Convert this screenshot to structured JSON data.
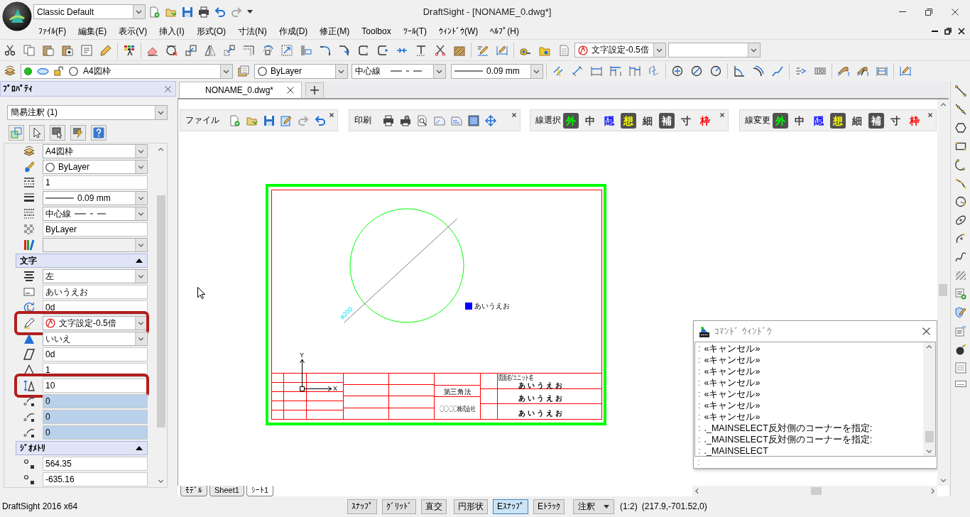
{
  "window": {
    "title": "DraftSight - [NONAME_0.dwg*]",
    "workspace": "Classic Default"
  },
  "menu": [
    "ﾌｧｲﾙ(F)",
    "編集(E)",
    "表示(V)",
    "挿入(I)",
    "形式(O)",
    "寸法(N)",
    "作成(D)",
    "修正(M)",
    "Toolbox",
    "ﾂｰﾙ(T)",
    "ｳｨﾝﾄﾞｳ(W)",
    "ﾍﾙﾌﾟ(H)"
  ],
  "toolbar": {
    "text_style": "文字設定-0.5倍"
  },
  "layer_bar": {
    "layer": "A4図枠",
    "color_setting": "ByLayer",
    "linetype": "中心線",
    "lineweight": "0.09 mm"
  },
  "properties": {
    "title": "ﾌﾟﾛﾊﾟﾃｨ",
    "selection": "簡易注釈 (1)",
    "rows": [
      {
        "kind": "dropdown",
        "value": "A4図枠",
        "disabled": false,
        "shaded": false,
        "highlighted": false
      },
      {
        "kind": "color",
        "value": "ByLayer",
        "disabled": false,
        "shaded": false,
        "highlighted": false
      },
      {
        "kind": "text",
        "value": "1",
        "disabled": false,
        "shaded": false,
        "highlighted": false
      },
      {
        "kind": "lineweight",
        "value": "0.09 mm",
        "disabled": false,
        "shaded": false,
        "highlighted": false
      },
      {
        "kind": "linetype",
        "value": "中心線",
        "disabled": false,
        "shaded": false,
        "highlighted": false
      },
      {
        "kind": "text",
        "value": "ByLayer",
        "disabled": false,
        "shaded": false,
        "highlighted": false
      },
      {
        "kind": "dropdown",
        "disabled": true,
        "shaded": false,
        "highlighted": false
      },
      {
        "kind": "section",
        "label": "文字",
        "expanded": true
      },
      {
        "kind": "dropdown",
        "value": "左",
        "disabled": false,
        "shaded": false,
        "highlighted": false
      },
      {
        "kind": "text",
        "value": "あいうえお",
        "disabled": false,
        "shaded": false,
        "highlighted": false
      },
      {
        "kind": "text",
        "value": "0d",
        "disabled": false,
        "shaded": false,
        "highlighted": false
      },
      {
        "kind": "style",
        "value": "文字設定-0.5倍",
        "disabled": false,
        "shaded": false,
        "highlighted": true
      },
      {
        "kind": "dropdown",
        "value": "いいえ",
        "disabled": false,
        "shaded": false,
        "highlighted": false
      },
      {
        "kind": "text",
        "value": "0d",
        "disabled": false,
        "shaded": false,
        "highlighted": false
      },
      {
        "kind": "text",
        "value": "1",
        "disabled": false,
        "shaded": false,
        "highlighted": false
      },
      {
        "kind": "text",
        "value": "10",
        "disabled": false,
        "shaded": false,
        "highlighted": true
      },
      {
        "kind": "text",
        "value": "0",
        "disabled": false,
        "shaded": true,
        "highlighted": false
      },
      {
        "kind": "text",
        "value": "0",
        "disabled": false,
        "shaded": true,
        "highlighted": false
      },
      {
        "kind": "text",
        "value": "0",
        "disabled": false,
        "shaded": true,
        "highlighted": false
      },
      {
        "kind": "section",
        "label": "ｼﾞｵﾒﾄﾘ",
        "expanded": true
      },
      {
        "kind": "text",
        "value": "564.35",
        "disabled": false,
        "shaded": false,
        "highlighted": false
      },
      {
        "kind": "text",
        "value": "-635.16",
        "disabled": false,
        "shaded": false,
        "highlighted": false
      }
    ]
  },
  "document_tabs": [
    {
      "label": "NONAME_0.dwg*",
      "selected": true
    }
  ],
  "floating_toolbars": [
    {
      "kind": "icons",
      "label": "ファイル"
    },
    {
      "kind": "icons",
      "label": "印刷"
    },
    {
      "kind": "lines",
      "label": "線選択",
      "buttons": [
        {
          "label": "外",
          "color": "#00ff00"
        },
        {
          "label": "中",
          "color": "#3c3c3c"
        },
        {
          "label": "隠",
          "color": "#0000ff"
        },
        {
          "label": "想",
          "color": "#ffff00"
        },
        {
          "label": "細",
          "color": "#3c3c3c"
        },
        {
          "label": "補",
          "color": "#ffffff"
        },
        {
          "label": "寸",
          "color": "#3c3c3c"
        },
        {
          "label": "枠",
          "color": "#ff0000"
        }
      ]
    },
    {
      "kind": "lines",
      "label": "線変更",
      "buttons": [
        {
          "label": "外",
          "color": "#00ff00"
        },
        {
          "label": "中",
          "color": "#3c3c3c"
        },
        {
          "label": "隠",
          "color": "#0000ff"
        },
        {
          "label": "想",
          "color": "#ffff00"
        },
        {
          "label": "細",
          "color": "#3c3c3c"
        },
        {
          "label": "補",
          "color": "#ffffff"
        },
        {
          "label": "寸",
          "color": "#3c3c3c"
        },
        {
          "label": "枠",
          "color": "#ff0000"
        }
      ]
    }
  ],
  "drawing": {
    "dimension": "ø200",
    "text": "あいうえお",
    "axes": {
      "x": "X",
      "y": "Y"
    },
    "title_block": {
      "notes": [
        "第三角法",
        "〇〇〇〇株式会社"
      ],
      "fields": [
        {
          "caption": "図面名/ユニット名",
          "value": "あいうえお"
        },
        {
          "value": "あいうえお"
        },
        {
          "value": "あいうえお"
        }
      ]
    }
  },
  "command_window": {
    "title": "ｺﾏﾝﾄﾞ ｳｨﾝﾄﾞｳ",
    "lines": [
      {
        "mark": ":",
        "text": "«キャンセル»"
      },
      {
        "mark": ":",
        "text": "«キャンセル»"
      },
      {
        "mark": ":",
        "text": "«キャンセル»"
      },
      {
        "mark": ":",
        "text": "«キャンセル»"
      },
      {
        "mark": ":",
        "text": "«キャンセル»"
      },
      {
        "mark": ":",
        "text": "«キャンセル»"
      },
      {
        "mark": ":",
        "text": "«キャンセル»"
      },
      {
        "mark": ":",
        "text": "._MAINSELECT反対側のコーナーを指定:"
      },
      {
        "mark": ":",
        "text": "._MAINSELECT反対側のコーナーを指定:"
      },
      {
        "mark": ":",
        "text": "._MAINSELECT"
      }
    ],
    "prompt": ":"
  },
  "sheet_tabs": [
    {
      "label": "ﾓﾃﾞﾙ",
      "selected": false
    },
    {
      "label": "Sheet1",
      "selected": false
    },
    {
      "label": "ｼｰﾄ1",
      "selected": true
    }
  ],
  "status_bar": {
    "app": "DraftSight 2016 x64",
    "toggles": [
      {
        "label": "ｽﾅｯﾌﾟ",
        "on": false
      },
      {
        "label": "ｸﾞﾘｯﾄﾞ",
        "on": false
      },
      {
        "label": "直交",
        "on": false
      },
      {
        "label": "円形状",
        "on": false
      },
      {
        "label": "Eｽﾅｯﾌﾟ",
        "on": true
      },
      {
        "label": "Eﾄﾗｯｸ",
        "on": false
      }
    ],
    "annotation": "注釈",
    "scale": "(1:2)",
    "coordinates": "(217.9,-701.52,0)"
  }
}
